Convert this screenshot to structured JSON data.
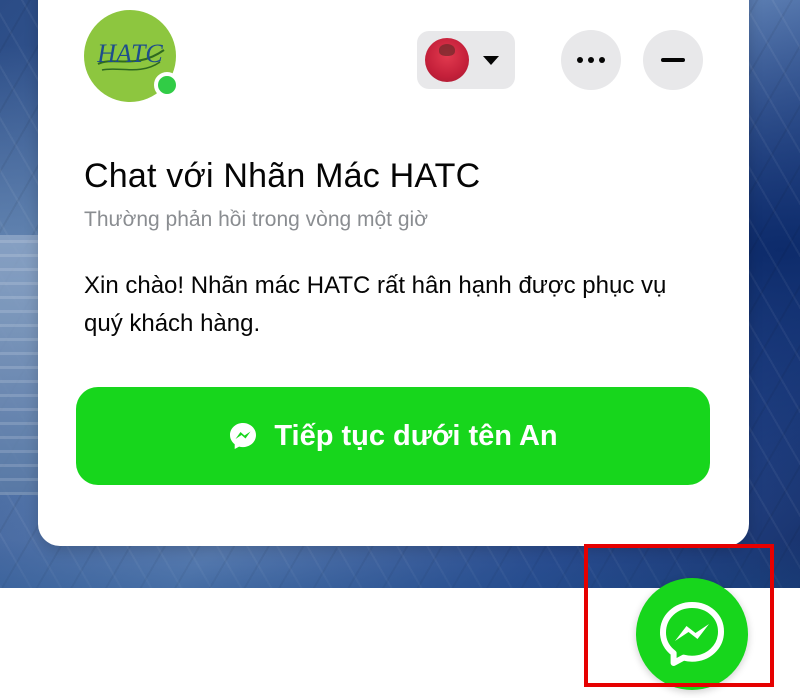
{
  "page": {
    "name": "Nhãn Mác HATC",
    "logo_text": "HATC",
    "title": "Chat với Nhãn Mác HATC",
    "response_time": "Thường phản hồi trong vòng một giờ",
    "greeting": "Xin chào! Nhãn mác HATC rất hân hạnh được phục vụ quý khách hàng.",
    "continue_label": "Tiếp tục dưới tên An",
    "online": true
  },
  "header_actions": {
    "profile_switcher": {
      "icon": "user-avatar",
      "caret_icon": "caret-down-icon"
    },
    "more_icon": "more-horizontal-icon",
    "minimize_icon": "minus-icon"
  },
  "fab": {
    "icon": "messenger-icon",
    "highlighted": true
  },
  "colors": {
    "accent": "#17d61c",
    "online": "#31cc46",
    "avatar_bg": "#8dc63f",
    "text_primary": "#050505",
    "text_secondary": "#8a8d91",
    "button_bg": "#e8e8ea",
    "highlight_box": "#e60000"
  }
}
